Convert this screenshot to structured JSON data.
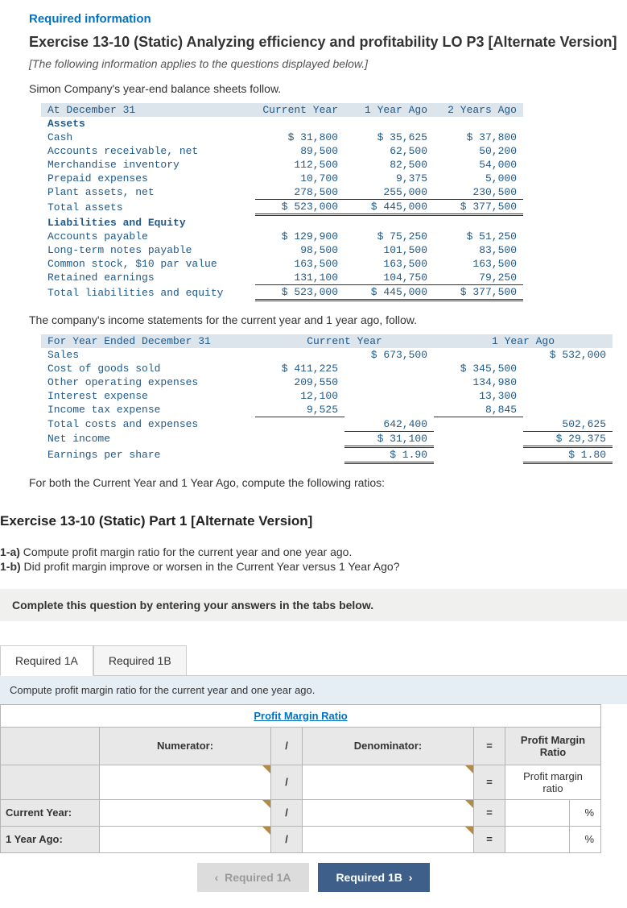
{
  "header": {
    "required": "Required information",
    "title": "Exercise 13-10 (Static) Analyzing efficiency and profitability LO P3 [Alternate Version]",
    "note": "[The following information applies to the questions displayed below.]",
    "intro": "Simon Company's year-end balance sheets follow."
  },
  "balance": {
    "col_date": "At December 31",
    "col_cur": "Current Year",
    "col_y1": "1 Year Ago",
    "col_y2": "2 Years Ago",
    "sec_assets": "Assets",
    "rows_assets": [
      {
        "l": "Cash",
        "c": "$ 31,800",
        "y1": "$ 35,625",
        "y2": "$ 37,800"
      },
      {
        "l": "Accounts receivable, net",
        "c": "89,500",
        "y1": "62,500",
        "y2": "50,200"
      },
      {
        "l": "Merchandise inventory",
        "c": "112,500",
        "y1": "82,500",
        "y2": "54,000"
      },
      {
        "l": "Prepaid expenses",
        "c": "10,700",
        "y1": "9,375",
        "y2": "5,000"
      },
      {
        "l": "Plant assets, net",
        "c": "278,500",
        "y1": "255,000",
        "y2": "230,500"
      }
    ],
    "total_assets": {
      "l": "Total assets",
      "c": "$ 523,000",
      "y1": "$ 445,000",
      "y2": "$ 377,500"
    },
    "sec_liab": "Liabilities and Equity",
    "rows_liab": [
      {
        "l": "Accounts payable",
        "c": "$ 129,900",
        "y1": "$ 75,250",
        "y2": "$ 51,250"
      },
      {
        "l": "Long-term notes payable",
        "c": "98,500",
        "y1": "101,500",
        "y2": "83,500"
      },
      {
        "l": "Common stock, $10 par value",
        "c": "163,500",
        "y1": "163,500",
        "y2": "163,500"
      },
      {
        "l": "Retained earnings",
        "c": "131,100",
        "y1": "104,750",
        "y2": "79,250"
      }
    ],
    "total_liab": {
      "l": "Total liabilities and equity",
      "c": "$ 523,000",
      "y1": "$ 445,000",
      "y2": "$ 377,500"
    }
  },
  "income_intro": "The company's income statements for the current year and 1 year ago, follow.",
  "income": {
    "col_date": "For Year Ended December 31",
    "col_cur": "Current Year",
    "col_y1": "1 Year Ago",
    "sales": {
      "l": "Sales",
      "c": "$ 673,500",
      "y1": "$ 532,000"
    },
    "rows": [
      {
        "l": "Cost of goods sold",
        "c": "$ 411,225",
        "y1": "$ 345,500"
      },
      {
        "l": "Other operating expenses",
        "c": "209,550",
        "y1": "134,980"
      },
      {
        "l": "Interest expense",
        "c": "12,100",
        "y1": "13,300"
      },
      {
        "l": "Income tax expense",
        "c": "9,525",
        "y1": "8,845"
      }
    ],
    "total_costs": {
      "l": "Total costs and expenses",
      "c": "642,400",
      "y1": "502,625"
    },
    "net_income": {
      "l": "Net income",
      "c": "$ 31,100",
      "y1": "$ 29,375"
    },
    "eps": {
      "l": "Earnings per share",
      "c": "$ 1.90",
      "y1": "$ 1.80"
    }
  },
  "ratios_intro": "For both the Current Year and 1 Year Ago, compute the following ratios:",
  "part": {
    "title": "Exercise 13-10 (Static) Part 1 [Alternate Version]",
    "qa_label": "1-a)",
    "qa": " Compute profit margin ratio for the current year and one year ago.",
    "qb_label": "1-b)",
    "qb": " Did profit margin improve or worsen in the Current Year versus 1 Year Ago?",
    "complete": "Complete this question by entering your answers in the tabs below."
  },
  "tabs": {
    "a": "Required 1A",
    "b": "Required 1B"
  },
  "tab_instr": "Compute profit margin ratio for the current year and one year ago.",
  "answer": {
    "title": "Profit Margin Ratio",
    "numerator": "Numerator:",
    "slash": "/",
    "denominator": "Denominator:",
    "eq": "=",
    "result_hdr": "Profit Margin Ratio",
    "result_placeholder": "Profit margin ratio",
    "row_cur": "Current Year:",
    "row_y1": "1 Year Ago:",
    "pct": "%"
  },
  "nav": {
    "prev": "Required 1A",
    "next": "Required 1B"
  }
}
